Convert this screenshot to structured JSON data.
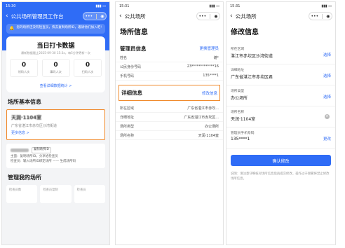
{
  "screen1": {
    "status_time": "15:30",
    "nav_title": "公共场所管理员工作台",
    "notice": "您的场所还没有检查员，快去复制场所ID，邀请他们加入吧!",
    "checkin_title": "当日打卡数据",
    "checkin_date": "最新数据截止2025-09-30 15:3x，每5分钟更新一次",
    "stats": [
      {
        "num": "0",
        "label": "领码人次"
      },
      {
        "num": "0",
        "label": "事码人次"
      },
      {
        "num": "0",
        "label": "扫码人次"
      }
    ],
    "detail_link": "查看详细数据统计 >",
    "basic_info_title": "场所基本信息",
    "venue_name": "天润·1104室",
    "venue_addr": "广东省湛江市赤坎区沙湾街道",
    "more_info": "更多信息 >",
    "copy_btn": "复制场所ID",
    "info_line1": "主面：复制场所ID，分享给检查员",
    "info_line2": "检查员：输入场所ID绑定场所 —— 生成场所码",
    "manage_title": "管理我的场所",
    "mgmt_cards": [
      "检查员数",
      "检查员复制",
      "检查员"
    ]
  },
  "screen2": {
    "status_time": "15:31",
    "nav_title": "公共场所",
    "page_title": "场所信息",
    "admin_section": "管理员信息",
    "change_admin": "更换管理员",
    "admin_rows": [
      {
        "k": "姓名",
        "v": "谢*"
      },
      {
        "k": "公民身份号码",
        "v": "23*************16"
      },
      {
        "k": "手机号码",
        "v": "135****1"
      }
    ],
    "detail_section": "详细信息",
    "modify_info": "修改信息",
    "detail_rows": [
      {
        "k": "所在区域",
        "v": "广东省湛江市赤坎..."
      },
      {
        "k": "详细地址",
        "v": "广东省湛江市赤坎区..."
      },
      {
        "k": "场所类型",
        "v": "办公场所"
      },
      {
        "k": "场所名称",
        "v": "天润·1104室"
      }
    ]
  },
  "screen3": {
    "status_time": "15:31",
    "nav_title": "公共场所",
    "page_title": "修改信息",
    "fields": [
      {
        "label": "所在区域",
        "value": "湛江市赤坎区沙湾街道",
        "action": "选择"
      },
      {
        "label": "详细地址",
        "value": "广东省湛江市赤坎区君",
        "action": "选择"
      },
      {
        "label": "场所类型",
        "value": "办公场所",
        "action": "选择"
      },
      {
        "label": "场所名称",
        "value": "天润·1104室",
        "action": ""
      },
      {
        "label": "管理员手机号码",
        "value": "135****1",
        "action": "更改"
      }
    ],
    "confirm_btn": "确认修改",
    "note": "说明：请注意仔细核对场所信息后再提交修改，操作过于频繁将禁止修改场所信息。"
  }
}
